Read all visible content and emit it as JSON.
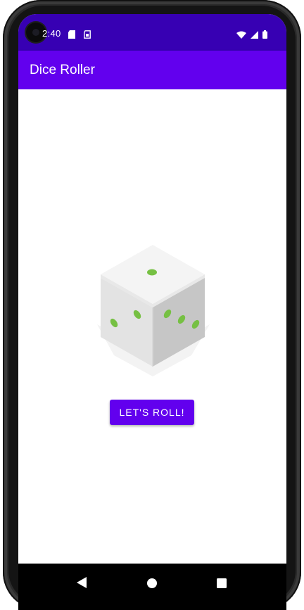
{
  "status_bar": {
    "time": "2:40",
    "icons_left": [
      "sd-card-icon",
      "sim-icon"
    ],
    "icons_right": [
      "wifi-icon",
      "signal-icon",
      "battery-icon"
    ]
  },
  "app_bar": {
    "title": "Dice Roller"
  },
  "main": {
    "dice_image": "dice-icon",
    "roll_button_label": "LET'S ROLL!"
  },
  "nav_bar": {
    "buttons": [
      "back",
      "home",
      "overview"
    ]
  },
  "colors": {
    "status_bar": "#3700b3",
    "app_bar": "#6200ee",
    "button": "#6200ee",
    "dice_pip": "#76c043"
  }
}
